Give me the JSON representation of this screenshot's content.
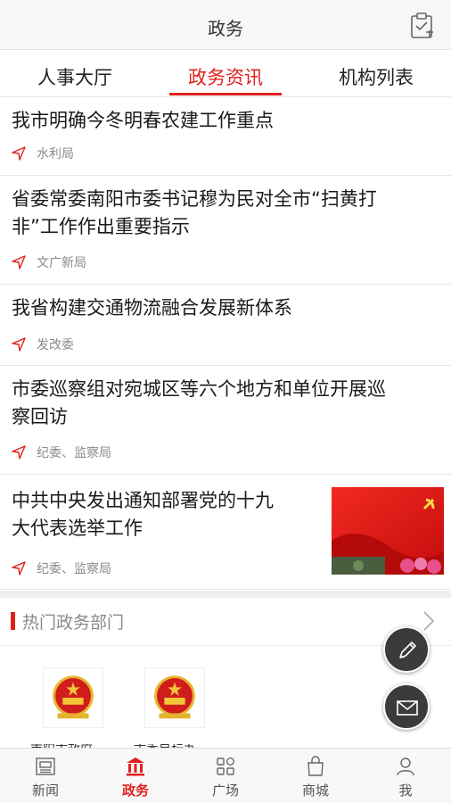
{
  "header": {
    "title": "政务"
  },
  "tabs": [
    {
      "label": "人事大厅"
    },
    {
      "label": "政务资讯"
    },
    {
      "label": "机构列表"
    }
  ],
  "news": [
    {
      "title": "我市明确今冬明春农建工作重点",
      "source": "水利局"
    },
    {
      "title_line1": "省委常委南阳市委书记穆为民对全市“扫黄打",
      "title_line2": "非”工作作出重要指示",
      "source": "文广新局"
    },
    {
      "title": "我省构建交通物流融合发展新体系",
      "source": "发改委"
    },
    {
      "title_line1": "市委巡察组对宛城区等六个地方和单位开展巡",
      "title_line2": "察回访",
      "source": "纪委、监察局"
    },
    {
      "title_line1": "中共中央发出通知部署党的十九",
      "title_line2": "大代表选举工作",
      "source": "纪委、监察局"
    }
  ],
  "section": {
    "title": "热门政务部门",
    "departments": [
      {
        "label": "南阳市政府"
      },
      {
        "label": "市委目标办"
      }
    ]
  },
  "tabbar": [
    {
      "label": "新闻"
    },
    {
      "label": "政务"
    },
    {
      "label": "广场"
    },
    {
      "label": "商城"
    },
    {
      "label": "我"
    }
  ],
  "colors": {
    "accent": "#e0201e",
    "fab": "#3b3b3b"
  },
  "icons": {
    "header_right": "clipboard-icon",
    "source": "send-arrow-icon",
    "fab_top": "pencil-icon",
    "fab_bottom": "mail-icon",
    "tabbar": [
      "newspaper-icon",
      "government-building-icon",
      "grid-icon",
      "shopping-bag-icon",
      "person-icon"
    ]
  }
}
